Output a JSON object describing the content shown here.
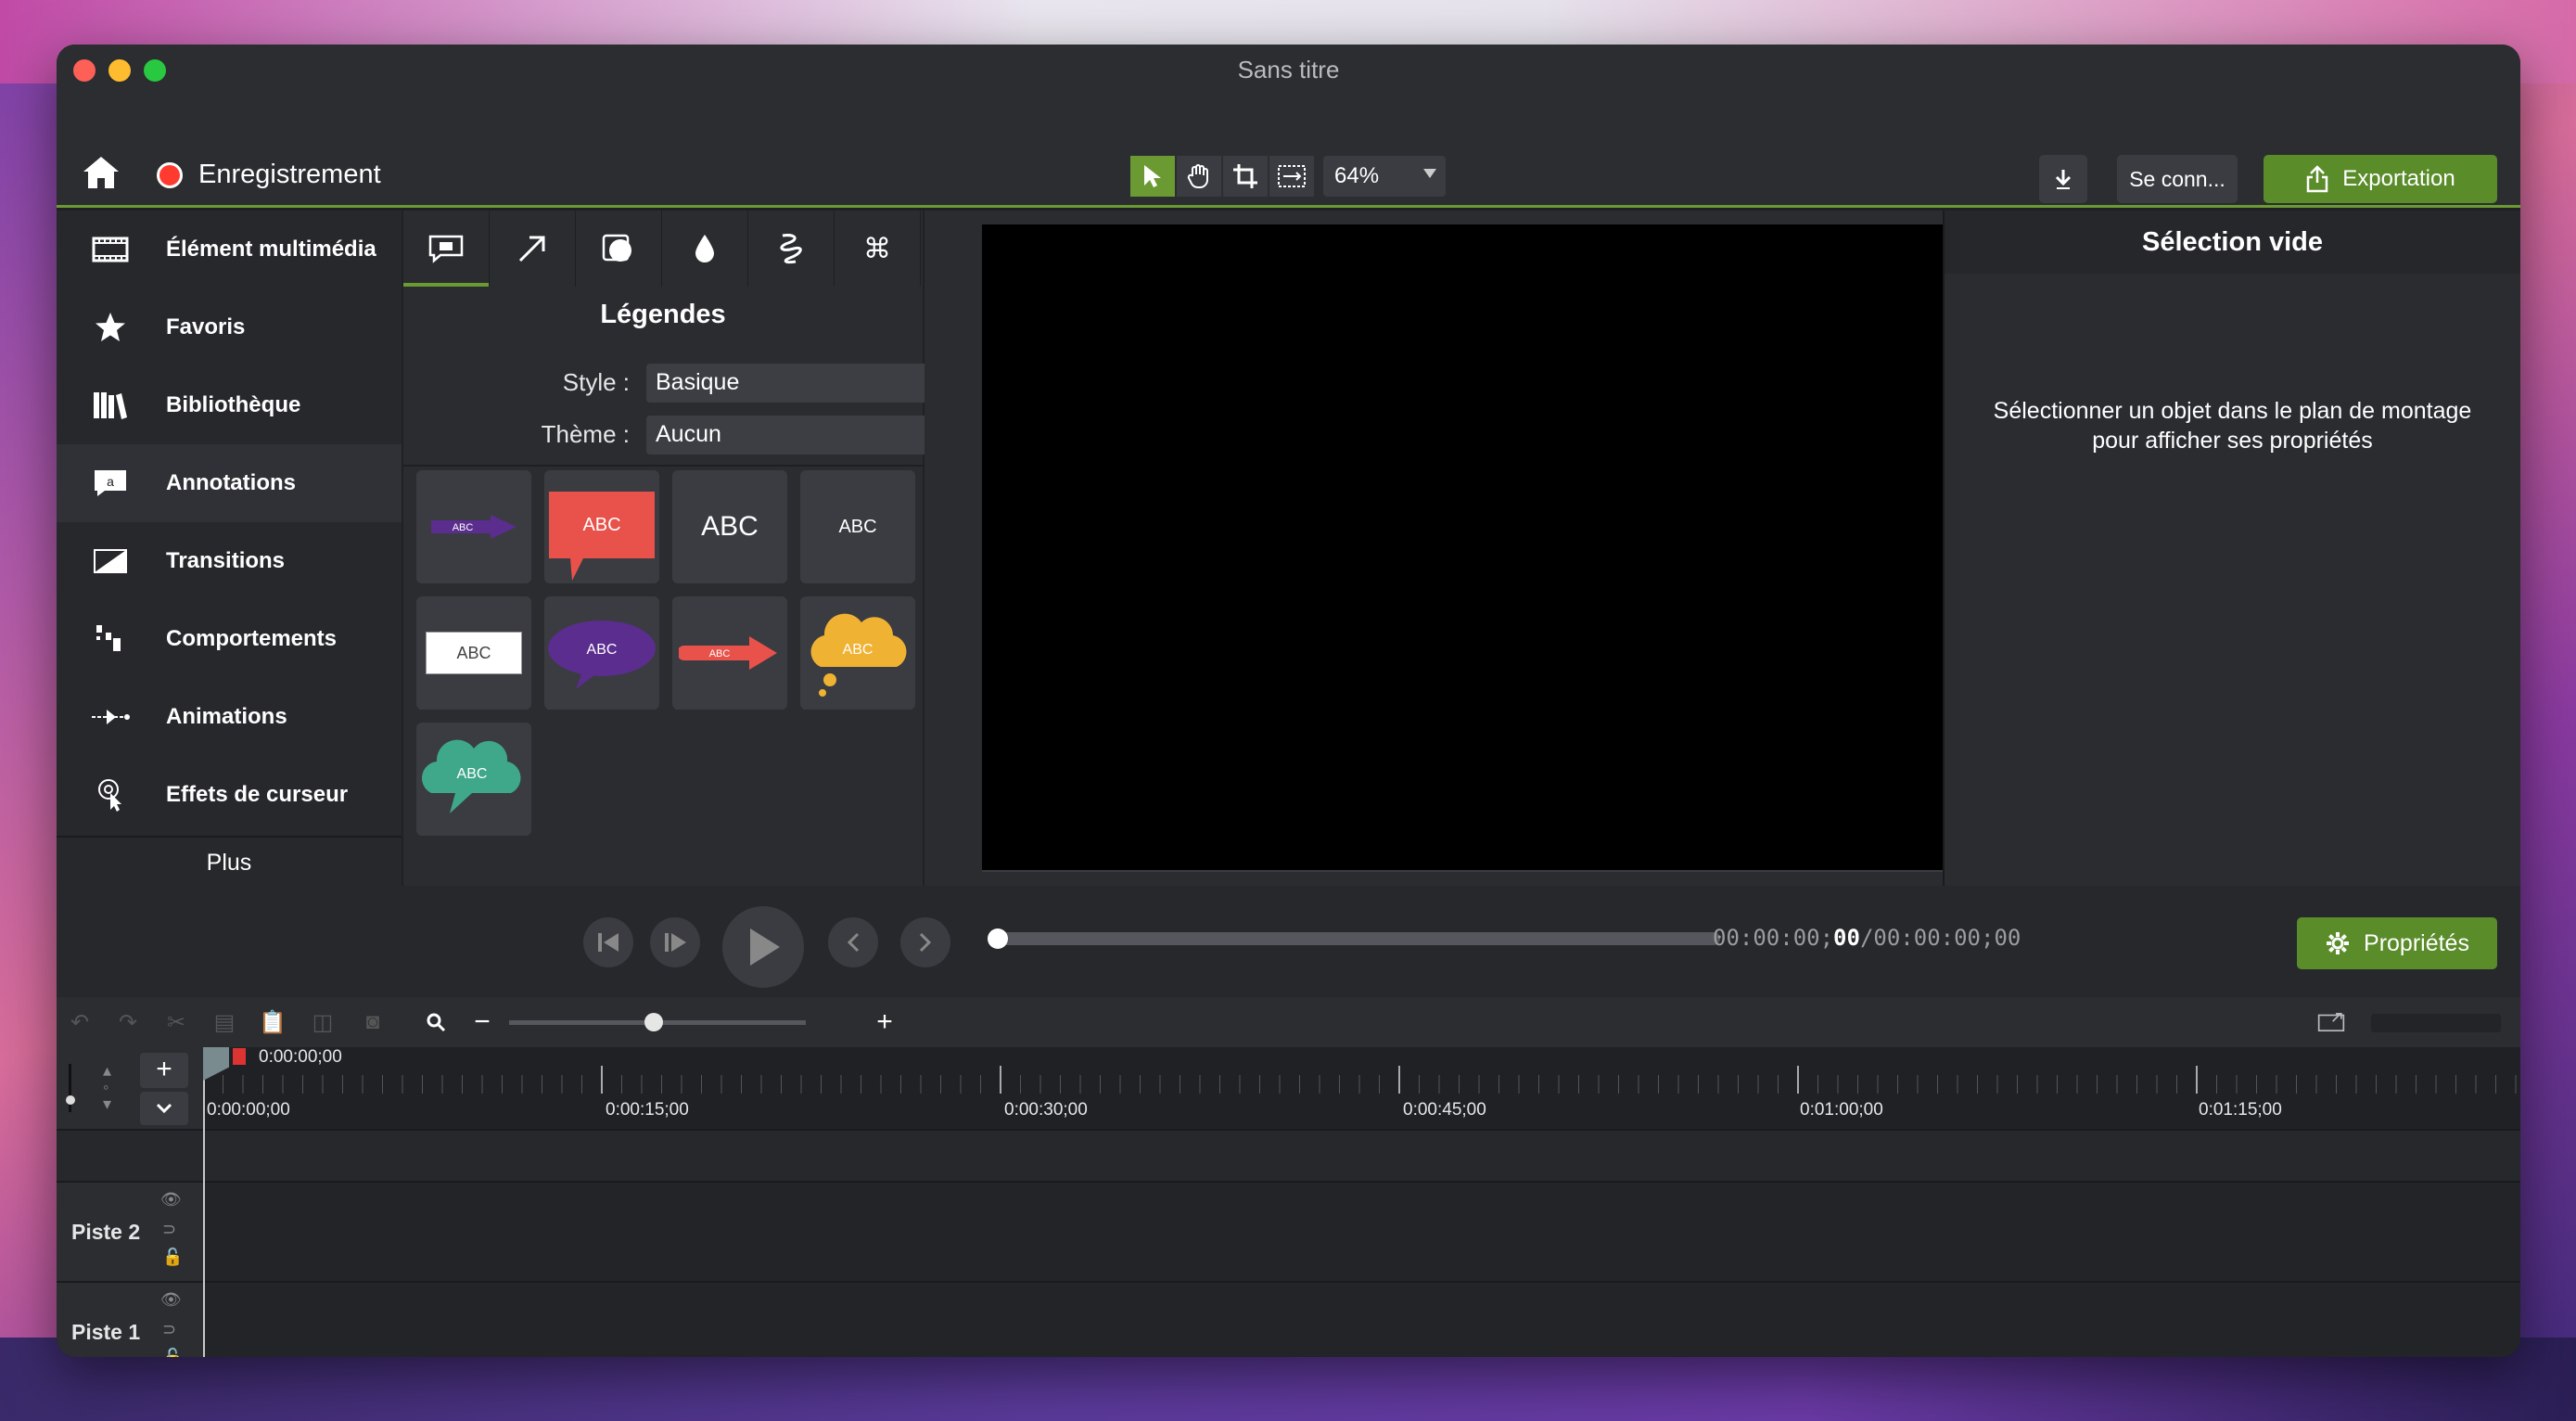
{
  "window": {
    "title": "Sans titre"
  },
  "toolbar": {
    "recording_label": "Enregistrement",
    "zoom_value": "64%",
    "signin_label": "Se conn...",
    "export_label": "Exportation",
    "tools": [
      "pointer-tool",
      "pan-tool",
      "crop-tool",
      "resize-tool"
    ]
  },
  "sidebar": {
    "items": [
      {
        "label": "Élément multimédia",
        "icon": "film-icon"
      },
      {
        "label": "Favoris",
        "icon": "star-icon"
      },
      {
        "label": "Bibliothèque",
        "icon": "library-icon"
      },
      {
        "label": "Annotations",
        "icon": "annotation-icon",
        "active": true
      },
      {
        "label": "Transitions",
        "icon": "transition-icon"
      },
      {
        "label": "Comportements",
        "icon": "behaviors-icon"
      },
      {
        "label": "Animations",
        "icon": "animation-icon"
      },
      {
        "label": "Effets de curseur",
        "icon": "cursor-effects-icon"
      }
    ],
    "more_label": "Plus"
  },
  "annotations_panel": {
    "tabs": [
      "callout-icon",
      "arrow-icon",
      "shape-icon",
      "blur-icon",
      "sketch-icon",
      "keystroke-icon"
    ],
    "title": "Légendes",
    "style_label": "Style :",
    "style_value": "Basique",
    "theme_label": "Thème :",
    "theme_value": "Aucun",
    "callouts": [
      {
        "type": "arrow-purple",
        "text": "ABC"
      },
      {
        "type": "speech-red",
        "text": "ABC"
      },
      {
        "type": "text-large",
        "text": "ABC"
      },
      {
        "type": "text-small",
        "text": "ABC"
      },
      {
        "type": "box-white",
        "text": "ABC"
      },
      {
        "type": "bubble-purple",
        "text": "ABC"
      },
      {
        "type": "arrow-red",
        "text": "ABC"
      },
      {
        "type": "cloud-yellow",
        "text": "ABC"
      },
      {
        "type": "cloud-green",
        "text": "ABC"
      }
    ],
    "colors": {
      "purple": "#5b2d8e",
      "red": "#e8524a",
      "yellow": "#f0b232",
      "green": "#3fa88a"
    }
  },
  "properties_panel": {
    "header": "Sélection vide",
    "message": "Sélectionner un objet dans le plan de montage pour afficher ses propriétés"
  },
  "transport": {
    "timecode_current_prefix": "00:00:00;",
    "timecode_current_frames": "00",
    "timecode_total": "/00:00:00;00",
    "properties_label": "Propriétés"
  },
  "timeline": {
    "playhead_time": "0:00:00;00",
    "ticks": [
      "0:00:00;00",
      "0:00:15;00",
      "0:00:30;00",
      "0:00:45;00",
      "0:01:00;00",
      "0:01:15;00"
    ],
    "tracks": [
      "Piste 2",
      "Piste 1"
    ]
  },
  "colors": {
    "accent": "#6b9a33",
    "export": "#5a8c2a",
    "record": "#ff3b30"
  }
}
